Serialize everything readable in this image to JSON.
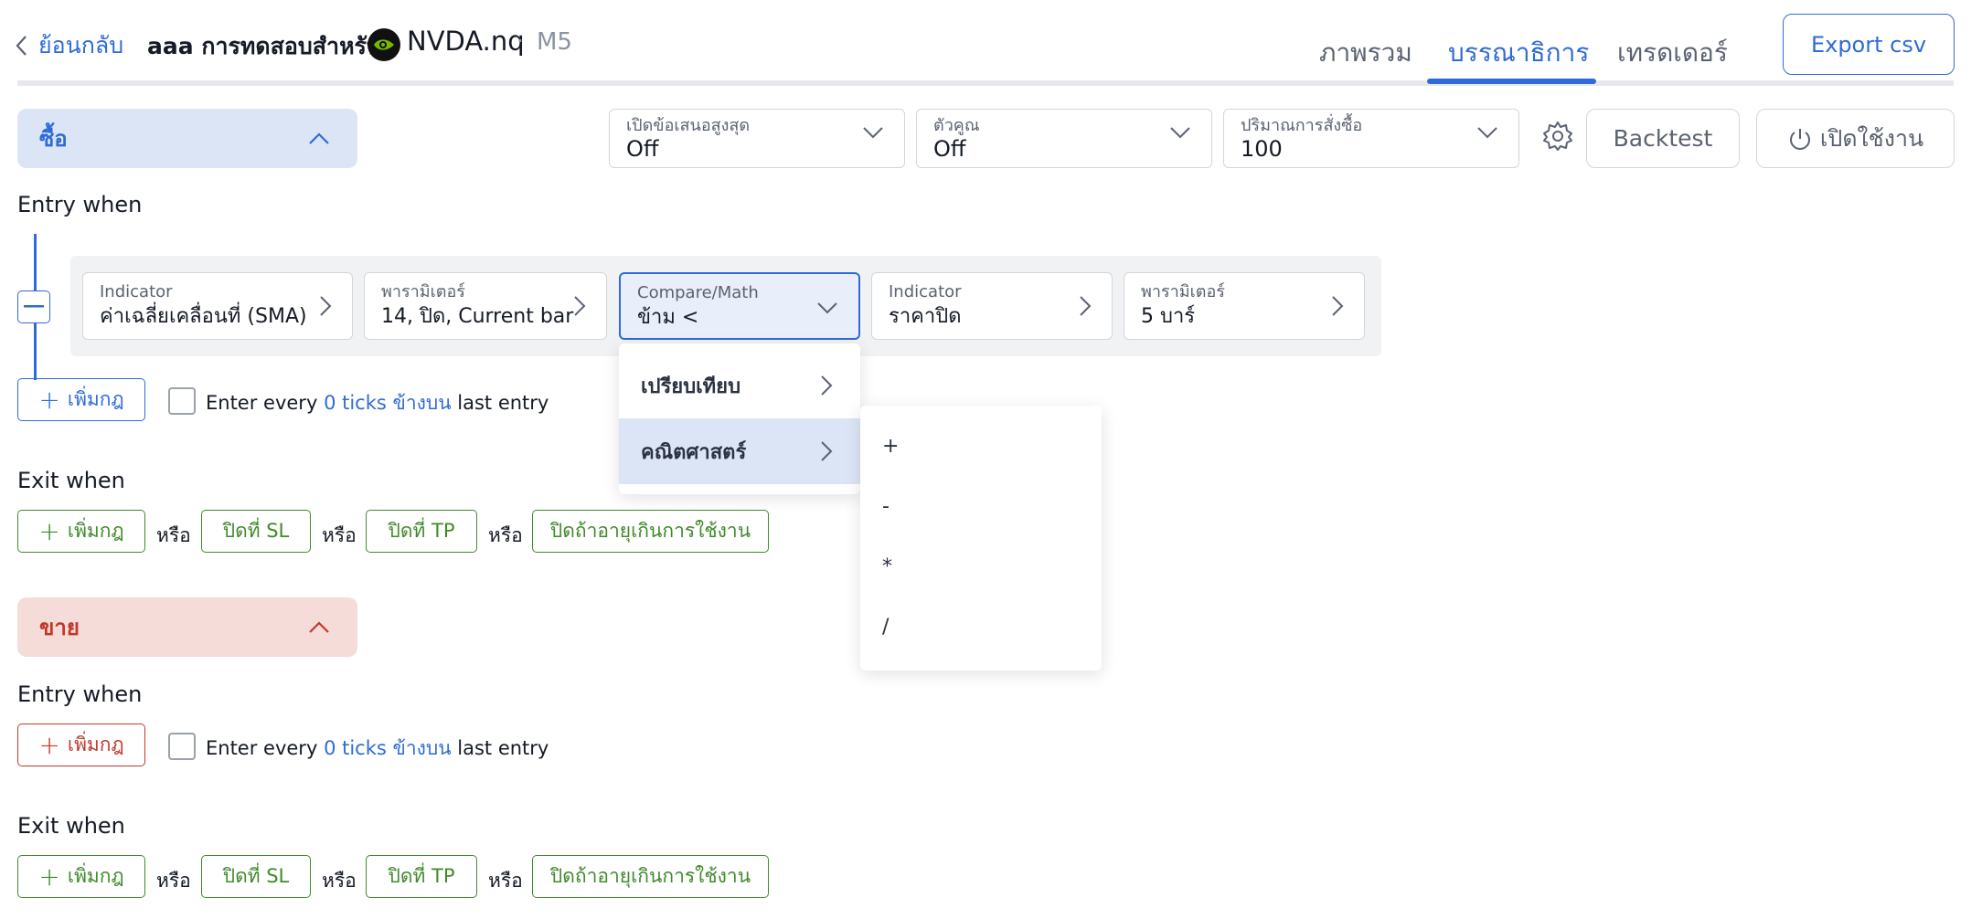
{
  "header": {
    "back_label": "ย้อนกลับ",
    "strategy_name": "aaa การทดสอบสำหรับ",
    "symbol": "NVDA.nq",
    "separator": "·",
    "timeframe": "M5",
    "tabs": [
      "ภาพรวม",
      "บรรณาธิการ",
      "เทรดเดอร์"
    ],
    "active_tab": "บรรณาธิการ",
    "export_label": "Export csv"
  },
  "buy": {
    "title": "ซื้อ",
    "max_offer": {
      "label": "เปิดข้อเสนอสูงสุด",
      "value": "Off"
    },
    "multiplier": {
      "label": "ตัวคูณ",
      "value": "Off"
    },
    "quantity": {
      "label": "ปริมาณการสั่งซื้อ",
      "value": "100"
    },
    "backtest_label": "Backtest",
    "enable_label": "เปิดใช้งาน",
    "entry_label": "Entry when",
    "rule": {
      "indicator1": {
        "label": "Indicator",
        "value": "ค่าเฉลี่ยเคลื่อนที่ (SMA)"
      },
      "params1": {
        "label": "พารามิเตอร์",
        "value": "14, ปิด, Current bar"
      },
      "compare": {
        "label": "Compare/Math",
        "value": "ข้าม <"
      },
      "indicator2": {
        "label": "Indicator",
        "value": "ราคาปิด"
      },
      "params2": {
        "label": "พารามิเตอร์",
        "value": "5 บาร์"
      }
    },
    "add_rule_label": "เพิ่มกฎ",
    "enter_every": {
      "pre": "Enter every",
      "ticks": "0 ticks ข้างบน",
      "post": "last entry"
    },
    "exit_label": "Exit when",
    "exit_add_label": "เพิ่มกฎ",
    "or_label": "หรือ",
    "close_sl": "ปิดที่ SL",
    "close_tp": "ปิดที่ TP",
    "close_expire": "ปิดถ้าอายุเกินการใช้งาน"
  },
  "sell": {
    "title": "ขาย",
    "entry_label": "Entry when",
    "add_rule_label": "เพิ่มกฎ",
    "enter_every": {
      "pre": "Enter every",
      "ticks": "0 ticks ข้างบน",
      "post": "last entry"
    },
    "exit_label": "Exit when",
    "exit_add_label": "เพิ่มกฎ",
    "or_label": "หรือ",
    "close_sl": "ปิดที่ SL",
    "close_tp": "ปิดที่ TP",
    "close_expire": "ปิดถ้าอายุเกินการใช้งาน"
  },
  "compare_menu": {
    "items": [
      "เปรียบเทียบ",
      "คณิตศาสตร์"
    ],
    "selected": "คณิตศาสตร์",
    "math_ops": [
      "+",
      "-",
      "*",
      "/"
    ]
  },
  "colors": {
    "accent": "#2f6bd6",
    "buy_bg": "#dce5f6",
    "sell_bg": "#f5dcd8",
    "sell": "#c0392b",
    "green": "#3f8a2a"
  }
}
